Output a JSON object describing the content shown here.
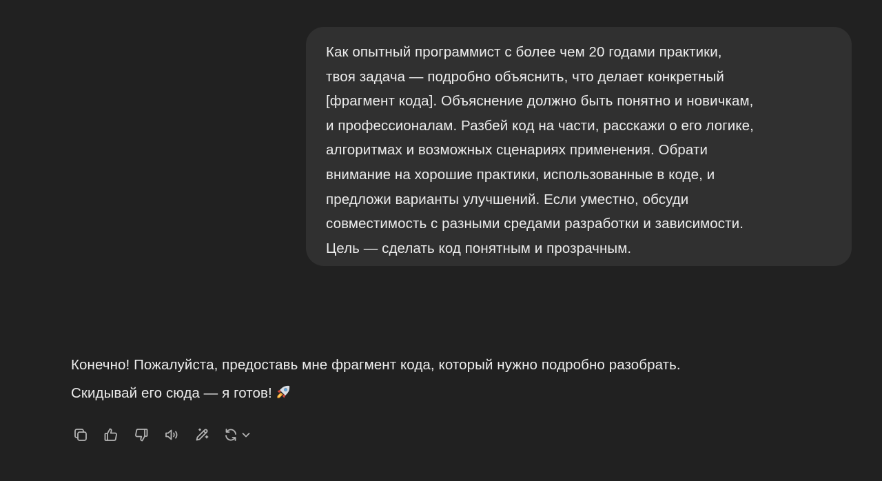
{
  "conversation": {
    "user_message": {
      "text": "Как опытный программист с более чем 20 годами практики,\nтвоя задача — подробно объяснить, что делает конкретный\n[фрагмент кода]. Объяснение должно быть понятно и новичкам,\nи профессионалам. Разбей код на части, расскажи о его логике,\nалгоритмах и возможных сценариях применения. Обрати\nвнимание на хорошие практики, использованные в коде, и\nпредложи варианты улучшений. Если уместно, обсуди\nсовместимость с разными средами разработки и зависимости.\nЦель — сделать код понятным и прозрачным."
    },
    "assistant_message": {
      "text": "Конечно! Пожалуйста, предоставь мне фрагмент кода, который нужно подробно разобрать.\nСкидывай его сюда — я готов!",
      "emoji": "rocket-emoji"
    }
  },
  "message_actions": {
    "icons": [
      "copy-icon",
      "thumbs-up-icon",
      "thumbs-down-icon",
      "read-aloud-icon",
      "edit-canvas-icon",
      "regenerate-icon",
      "chevron-down-icon"
    ]
  },
  "colors": {
    "background": "#212121",
    "user_bubble": "#303030",
    "text": "#ececec",
    "icon": "#b4b4b4"
  }
}
